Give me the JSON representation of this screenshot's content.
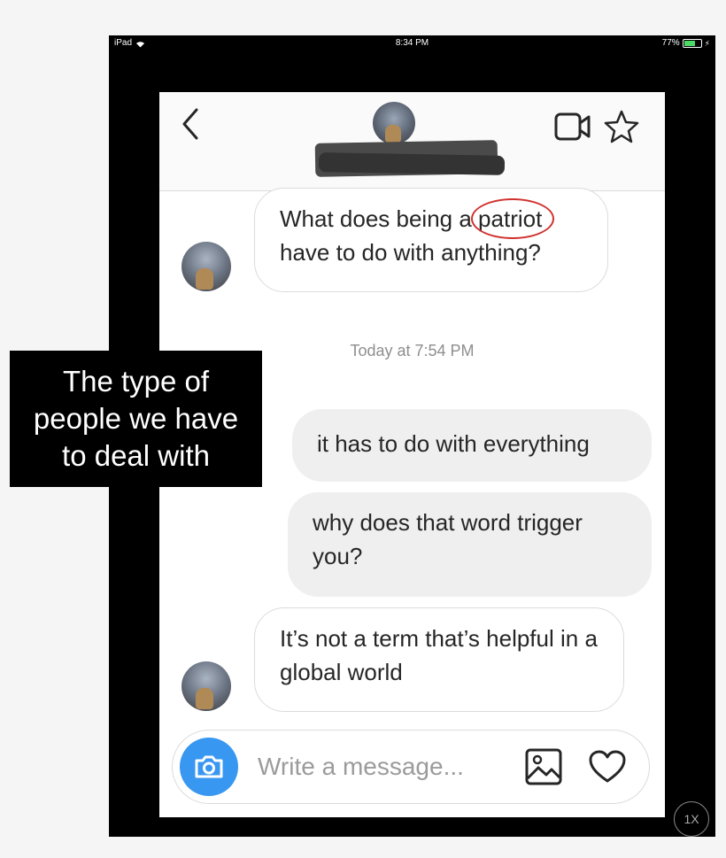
{
  "status_bar": {
    "device": "iPad",
    "time": "8:34 PM",
    "battery": "77%",
    "battery_level": 0.77
  },
  "header": {
    "back_icon": "chevron-left-icon",
    "video_icon": "video-camera-icon",
    "star_icon": "star-icon"
  },
  "messages": [
    {
      "from": "them",
      "text_before": "What does being a ",
      "text_circled": "patriot",
      "text_after": " have to do with anything?"
    },
    {
      "from": "me",
      "text": "it has to do with everything"
    },
    {
      "from": "me",
      "text": "why does that word trigger you?"
    },
    {
      "from": "them",
      "text": "It’s not a term that’s helpful in a global world"
    }
  ],
  "timestamp": "Today at 7:54 PM",
  "composer": {
    "placeholder": "Write a message...",
    "camera_icon": "camera-icon",
    "gallery_icon": "image-icon",
    "heart_icon": "heart-icon"
  },
  "caption": {
    "line1": "The type of",
    "line2": "people we have",
    "line3": "to deal with"
  },
  "zoom_badge": "1X",
  "colors": {
    "accent": "#3897f0",
    "annotation": "#d0312d",
    "outgoing_bubble": "#efefef"
  }
}
